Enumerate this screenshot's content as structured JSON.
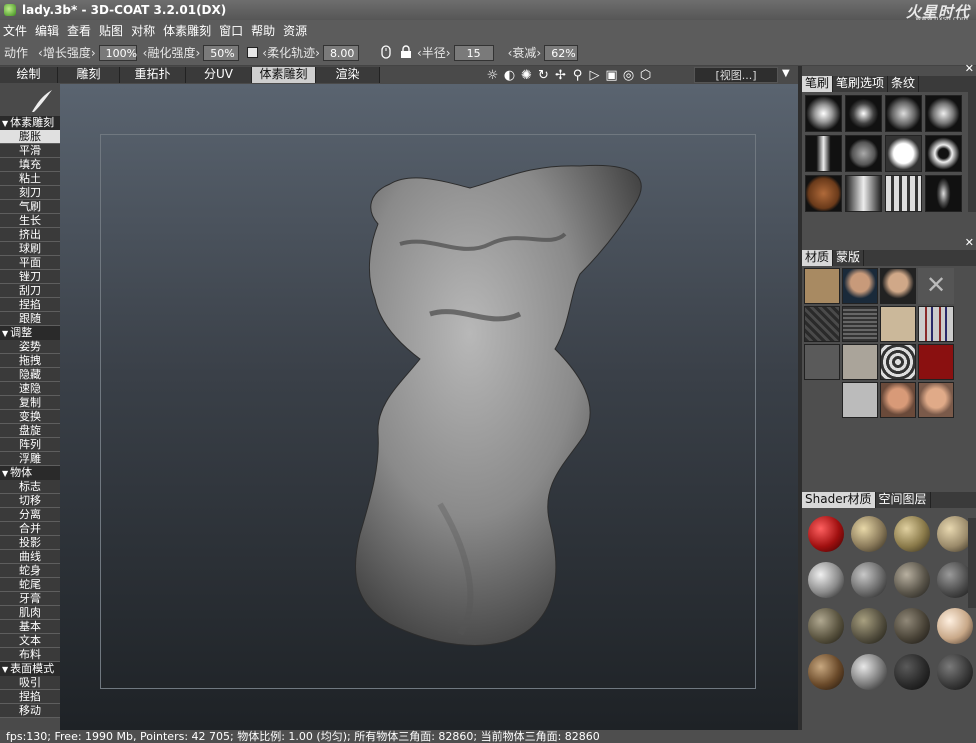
{
  "window": {
    "title": "lady.3b* - 3D-COAT 3.2.01(DX)",
    "watermark": "火星时代",
    "watermark_url": "www.hxsd.com"
  },
  "menu": [
    "文件",
    "编辑",
    "查看",
    "贴图",
    "对称",
    "体素雕刻",
    "窗口",
    "帮助",
    "资源"
  ],
  "toolbar": {
    "action_label": "动作",
    "growth_label": "增长强度",
    "growth_value": "100%",
    "melt_label": "融化强度",
    "melt_value": "50%",
    "smooth_path_label": "柔化轨迹",
    "smooth_path_value": "8.00",
    "radius_label": "半径",
    "radius_value": "15",
    "falloff_label": "衰减",
    "falloff_value": "62%"
  },
  "tabs": [
    {
      "label": "绘制"
    },
    {
      "label": "雕刻"
    },
    {
      "label": "重拓扑"
    },
    {
      "label": "分UV"
    },
    {
      "label": "体素雕刻",
      "active": true
    },
    {
      "label": "渲染"
    }
  ],
  "view_dropdown": "[视图...]",
  "left_panel": {
    "sections": [
      {
        "title": "体素雕刻",
        "items": [
          "膨胀",
          "平滑",
          "填充",
          "粘土",
          "刻刀",
          "气刷",
          "生长",
          "挤出",
          "球刷",
          "平面",
          "锉刀",
          "刮刀",
          "捏掐",
          "跟随"
        ],
        "selected": 0
      },
      {
        "title": "调整",
        "items": [
          "姿势",
          "拖拽",
          "隐藏",
          "速隐",
          "复制",
          "变换",
          "盘旋",
          "阵列",
          "浮雕"
        ]
      },
      {
        "title": "物体",
        "items": [
          "标志",
          "切移",
          "分离",
          "合并",
          "投影",
          "曲线",
          "蛇身",
          "蛇尾",
          "牙膏",
          "肌肉",
          "基本",
          "文本",
          "布料"
        ]
      },
      {
        "title": "表面模式",
        "items": [
          "吸引",
          "捏掐",
          "移动"
        ]
      }
    ]
  },
  "panels": {
    "brush": {
      "tabs": [
        "笔刷",
        "笔刷选项",
        "条纹"
      ]
    },
    "material": {
      "tabs": [
        "材质",
        "蒙版"
      ]
    },
    "shader": {
      "tabs": [
        "Shader材质",
        "空间图层"
      ]
    }
  },
  "colors": {
    "accent": "#d8d8d8",
    "viewport_top": "#5a6470",
    "viewport_bottom": "#1e2226"
  },
  "status": "fps:130;    Free: 1990 Mb, Pointers: 42 705; 物体比例: 1.00 (均匀); 所有物体三角面: 82860; 当前物体三角面: 82860"
}
